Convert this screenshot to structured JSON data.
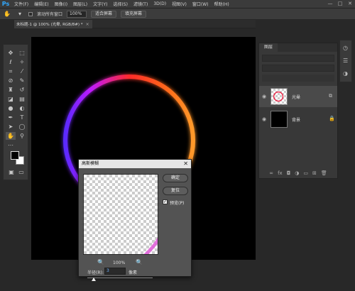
{
  "app": {
    "logo": "Ps"
  },
  "menu": [
    "文件(F)",
    "编辑(E)",
    "图像(I)",
    "图层(L)",
    "文字(Y)",
    "选择(S)",
    "滤镜(T)",
    "3D(D)",
    "视图(V)",
    "窗口(W)",
    "帮助(H)"
  ],
  "window_controls": [
    "—",
    "□",
    "✕"
  ],
  "options": {
    "scroll_all_label": "滚动所有窗口",
    "zoom_value": "100%",
    "fit_screen": "适合屏幕",
    "fill_screen": "填充屏幕"
  },
  "document": {
    "tab_title": "未标题-1 @ 100% (光晕, RGB/8#) *",
    "close": "×"
  },
  "layers_panel": {
    "tab": "图层",
    "layers": [
      {
        "name": "光晕",
        "selected": true
      },
      {
        "name": "背景",
        "selected": false
      }
    ],
    "bottom_icons": [
      "link-icon",
      "fx-icon",
      "mask-icon",
      "adjust-icon",
      "folder-icon",
      "new-layer-icon",
      "trash-icon"
    ]
  },
  "dialog": {
    "title": "高斯模糊",
    "close": "✕",
    "ok": "确定",
    "reset": "复位",
    "preview_label": "预览(P)",
    "preview_checked": true,
    "zoom_out": "🔍",
    "zoom_level": "100%",
    "zoom_in": "🔍",
    "radius_label": "半径(R):",
    "radius_value": "3",
    "radius_unit": "像素",
    "radius_slider_fraction": 0.1
  },
  "colors": {
    "accent": "#31a8ff",
    "ring_colors": [
      "#ff2a2a",
      "#ff8a1a",
      "#c01aff",
      "#5a2aff"
    ]
  }
}
